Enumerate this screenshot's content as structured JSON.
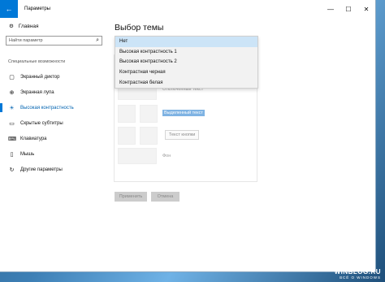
{
  "window": {
    "title": "Параметры",
    "back_icon": "arrow-left-icon",
    "minimize": "—",
    "maximize": "☐",
    "close": "✕"
  },
  "sidebar": {
    "home_label": "Главная",
    "search_placeholder": "Найти параметр",
    "section_title": "Специальные возможности",
    "items": [
      {
        "label": "Экранный диктор",
        "icon": "narrator-icon",
        "glyph": "▢"
      },
      {
        "label": "Экранная лупа",
        "icon": "magnifier-icon",
        "glyph": "⊕"
      },
      {
        "label": "Высокая контрастность",
        "icon": "contrast-icon",
        "glyph": "☀",
        "active": true
      },
      {
        "label": "Скрытые субтитры",
        "icon": "captions-icon",
        "glyph": "▭"
      },
      {
        "label": "Клавиатура",
        "icon": "keyboard-icon",
        "glyph": "⌨"
      },
      {
        "label": "Мышь",
        "icon": "mouse-icon",
        "glyph": "▯"
      },
      {
        "label": "Другие параметры",
        "icon": "other-settings-icon",
        "glyph": "↻"
      }
    ]
  },
  "main": {
    "title": "Выбор темы",
    "dropdown": {
      "selected": "Нет",
      "options": [
        "Нет",
        "Высокая контрастность 1",
        "Высокая контрастность 2",
        "Контрастная черная",
        "Контрастная белая"
      ]
    },
    "preview": {
      "disabled_text": "Отключенный текст",
      "selected_text": "Выделенный текст",
      "button_text": "Текст кнопки",
      "background": "Фон"
    },
    "apply_label": "Применить",
    "cancel_label": "Отмена"
  },
  "watermark": {
    "text": "WINBLOG.RU",
    "sub": "ВСЁ О WINDOWS"
  },
  "colors": {
    "accent": "#0078d7",
    "selection": "#cce4f7",
    "highlight": "#7fb3e3"
  }
}
